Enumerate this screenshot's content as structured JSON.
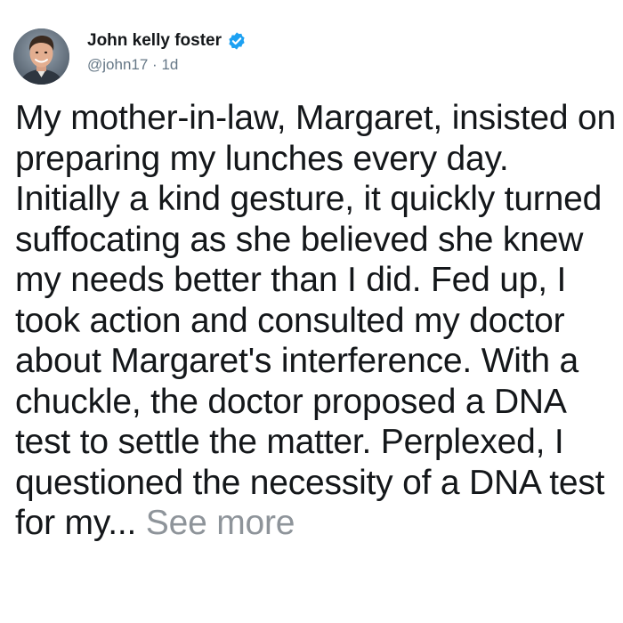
{
  "author": {
    "display_name": "John kelly foster",
    "handle": "@john17",
    "separator": "·",
    "timestamp": "1d",
    "verified": true,
    "avatar_icon": "profile-photo"
  },
  "tweet": {
    "body": "My mother-in-law, Margaret, insisted on preparing my lunches every day. Initially a kind gesture, it quickly turned suffocating as she believed she knew my needs better than I did. Fed up, I took action and consulted my doctor about Margaret's interference. With a chuckle, the doctor proposed a DNA test to settle the matter. Perplexed, I questioned the necessity of a DNA test for my...",
    "see_more_label": "See more"
  },
  "colors": {
    "text": "#14171a",
    "secondary": "#657786",
    "see_more": "#8e949a",
    "verified_badge": "#1da1f2"
  }
}
